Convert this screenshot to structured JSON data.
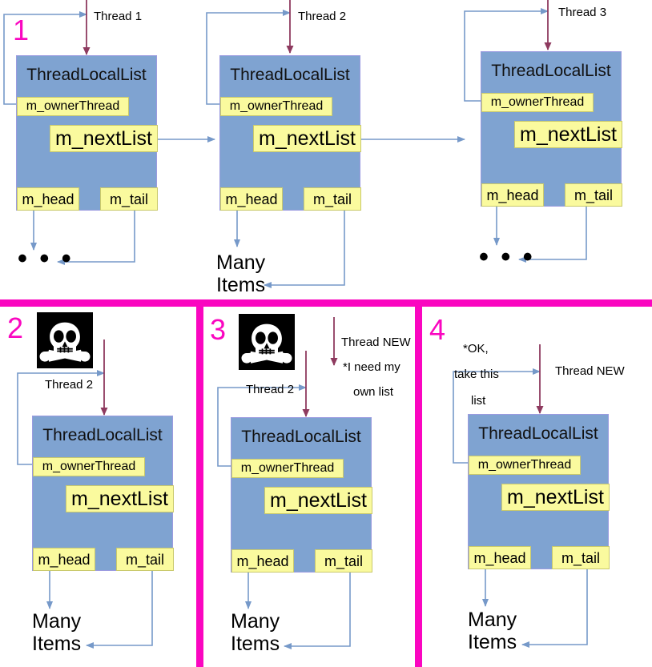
{
  "diagram": {
    "title": "ThreadLocalList linked-list ownership transfer",
    "colors": {
      "struct_fill": "#7FA3D1",
      "struct_border": "#9B9BE0",
      "field_fill": "#FAFA9E",
      "field_border": "#C9C96C",
      "magenta": "#FA06C0",
      "blue_arrow": "#7699C9",
      "maroon_arrow": "#8E3A5F",
      "text": "#000000"
    },
    "struct_name": "ThreadLocalList",
    "fields": {
      "owner": "m_ownerThread",
      "next": "m_nextList",
      "head": "m_head",
      "tail": "m_tail"
    },
    "ellipsis": "• • •",
    "many_items": "Many\nItems",
    "many_items_line1": "Many",
    "many_items_line2": "Items"
  },
  "panels": [
    {
      "number": "1",
      "nodes": [
        {
          "id": "n1",
          "struct_name": "ThreadLocalList",
          "owner": "m_ownerThread",
          "next": "m_nextList",
          "head": "m_head",
          "tail": "m_tail",
          "thread_label": "Thread 1",
          "bottom_label": "• • •",
          "bottom_kind": "ellipsis"
        },
        {
          "id": "n2",
          "struct_name": "ThreadLocalList",
          "owner": "m_ownerThread",
          "next": "m_nextList",
          "head": "m_head",
          "tail": "m_tail",
          "thread_label": "Thread 2",
          "bottom_label": "Many Items",
          "bottom_kind": "many"
        },
        {
          "id": "n3",
          "struct_name": "ThreadLocalList",
          "owner": "m_ownerThread",
          "next": "m_nextList",
          "head": "m_head",
          "tail": "m_tail",
          "thread_label": "Thread 3",
          "bottom_label": "• • •",
          "bottom_kind": "ellipsis"
        }
      ],
      "skull": false
    },
    {
      "number": "2",
      "skull": true,
      "skull_name": "skull-and-crossbones-icon",
      "thread_label": "Thread 2",
      "struct_name": "ThreadLocalList",
      "owner": "m_ownerThread",
      "next": "m_nextList",
      "head": "m_head",
      "tail": "m_tail",
      "bottom_line1": "Many",
      "bottom_line2": "Items"
    },
    {
      "number": "3",
      "skull": true,
      "skull_name": "skull-and-crossbones-icon",
      "thread_label": "Thread 2",
      "new_thread_label": "Thread NEW",
      "note_line1": "*I need my",
      "note_line2": "own list",
      "struct_name": "ThreadLocalList",
      "owner": "m_ownerThread",
      "next": "m_nextList",
      "head": "m_head",
      "tail": "m_tail",
      "bottom_line1": "Many",
      "bottom_line2": "Items"
    },
    {
      "number": "4",
      "skull": false,
      "note_line1": "*OK,",
      "note_line2": "take this",
      "note_line3": "list",
      "new_thread_label": "Thread NEW",
      "struct_name": "ThreadLocalList",
      "owner": "m_ownerThread",
      "next": "m_nextList",
      "head": "m_head",
      "tail": "m_tail",
      "bottom_line1": "Many",
      "bottom_line2": "Items"
    }
  ]
}
